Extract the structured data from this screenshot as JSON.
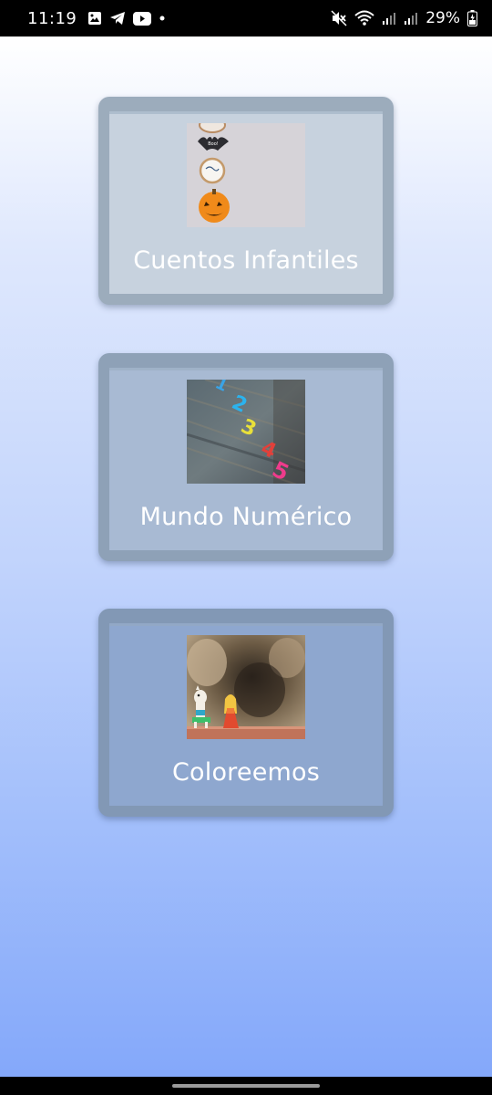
{
  "status_bar": {
    "time": "11:19",
    "battery": "29%",
    "left_icons": [
      "gallery-icon",
      "telegram-icon",
      "youtube-icon",
      "dot-icon"
    ],
    "right_icons": [
      "mute-icon",
      "wifi-icon",
      "signal-icon",
      "signal-icon",
      "battery-icon"
    ]
  },
  "cards": [
    {
      "title": "Cuentos Infantiles",
      "image": "halloween-cookies-image",
      "background": "#c7d2de"
    },
    {
      "title": "Mundo Numérico",
      "image": "number-magnets-image",
      "background": "#a8bad3"
    },
    {
      "title": "Coloreemos",
      "image": "toy-figures-image",
      "background": "#8ea7cf"
    }
  ],
  "colors": {
    "gradient_top": "#ffffff",
    "gradient_bottom": "#84a8fa",
    "title_text": "#ffffff"
  }
}
